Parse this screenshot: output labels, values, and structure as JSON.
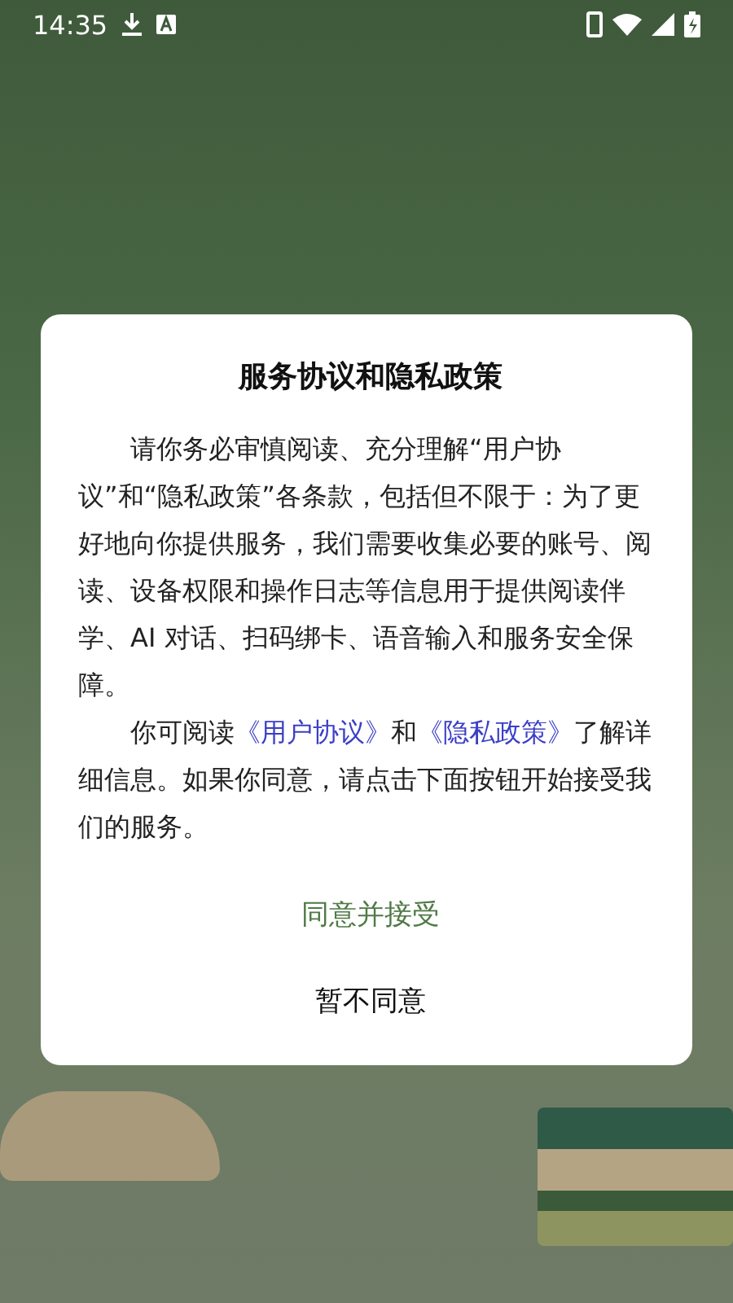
{
  "status_bar": {
    "time": "14:35"
  },
  "dialog": {
    "title": "服务协议和隐私政策",
    "paragraphs": [
      [
        {
          "kind": "text",
          "text": "请你务必审慎阅读、充分理解“用户协议”和“隐私政策”各条款，包括但不限于：为了更好地向你提供服务，我们需要收集必要的账号、阅读、设备权限和操作日志等信息用于提供阅读伴学、AI 对话、扫码绑卡、语音输入和服务安全保障。"
        }
      ],
      [
        {
          "kind": "text",
          "text": "你可阅读"
        },
        {
          "kind": "link",
          "text": "《用户协议》"
        },
        {
          "kind": "text",
          "text": "和"
        },
        {
          "kind": "link",
          "text": "《隐私政策》"
        },
        {
          "kind": "text",
          "text": "了解详细信息。如果你同意，请点击下面按钮开始接受我们的服务。"
        }
      ]
    ],
    "buttons": [
      {
        "kind": "primary",
        "label": "同意并接受"
      },
      {
        "kind": "secondary",
        "label": "暂不同意"
      }
    ]
  }
}
